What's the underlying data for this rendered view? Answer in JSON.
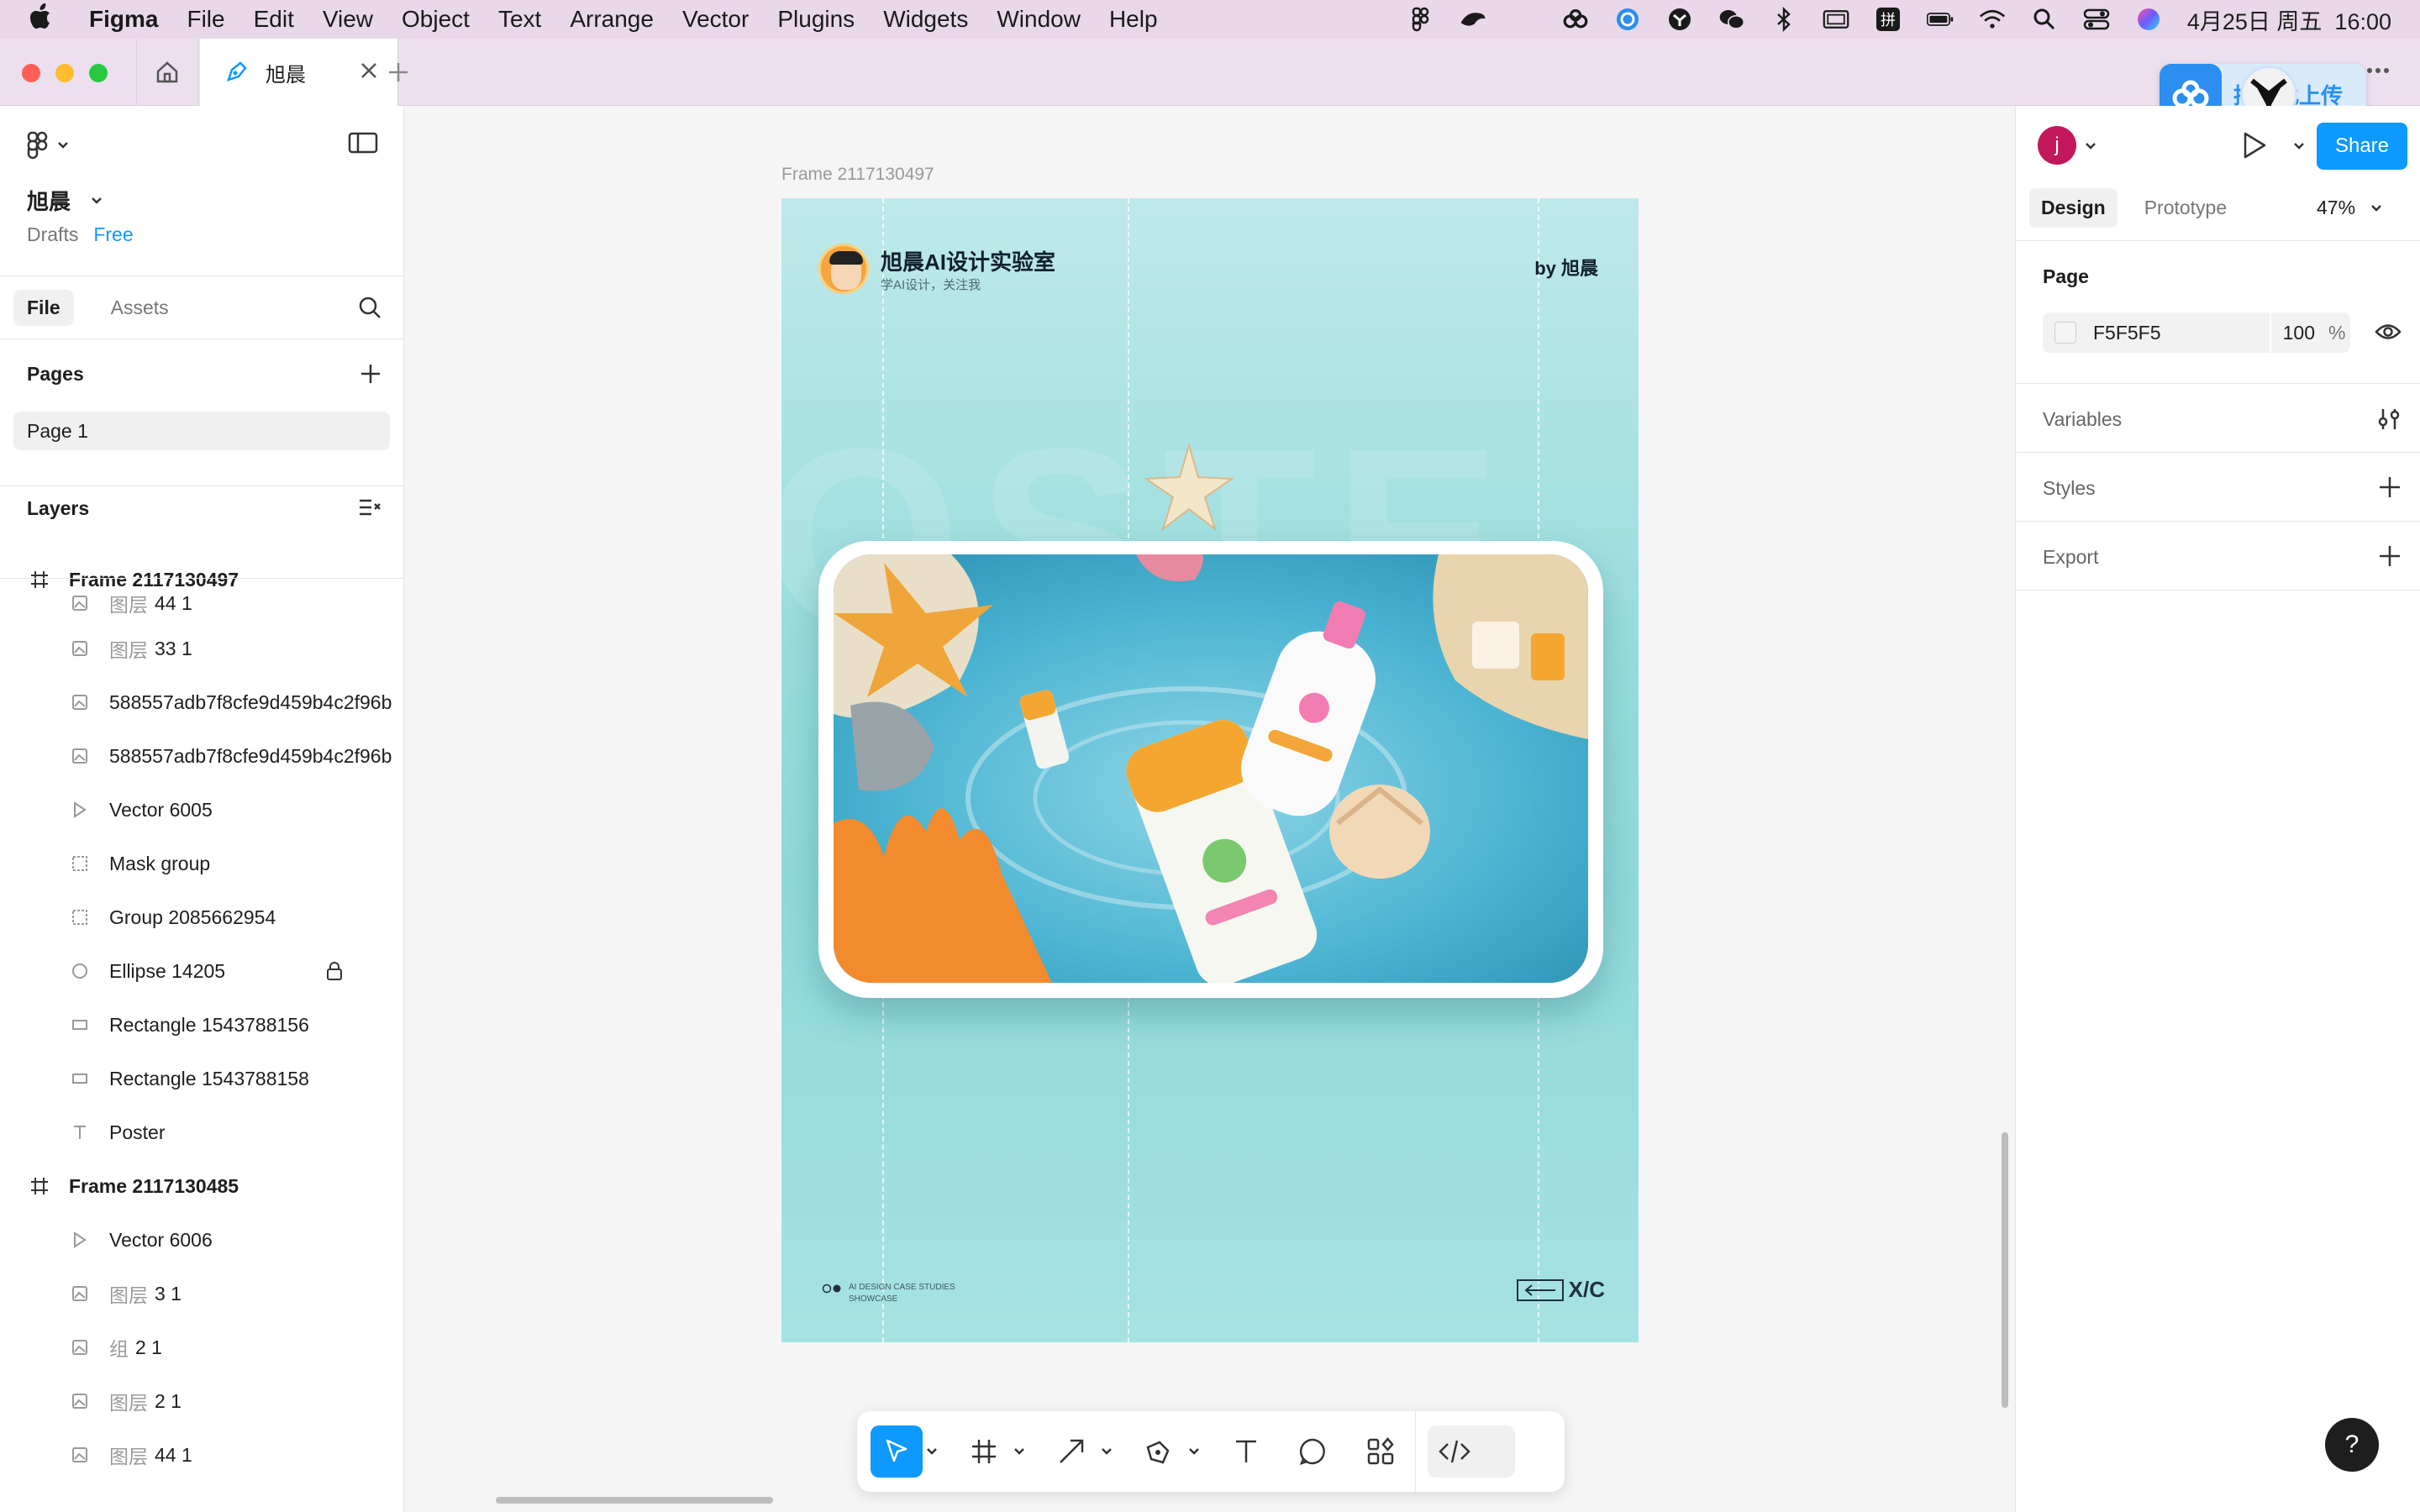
{
  "menubar": {
    "app": "Figma",
    "items": [
      "File",
      "Edit",
      "View",
      "Object",
      "Text",
      "Arrange",
      "Vector",
      "Plugins",
      "Widgets",
      "Window",
      "Help"
    ],
    "datetime": "4月25日 周五  16:00"
  },
  "tabs": {
    "active_label": "旭晨"
  },
  "upload_widget": {
    "label": "拖至此上传"
  },
  "left_panel": {
    "team_name": "旭晨",
    "drafts": "Drafts",
    "plan": "Free",
    "tabs": [
      "File",
      "Assets"
    ],
    "pages_heading": "Pages",
    "page_item": "Page 1",
    "layers_heading": "Layers",
    "layers": [
      {
        "prefix": "",
        "name": "Frame 2117130497"
      },
      {
        "prefix": "图层",
        "name": "44 1"
      },
      {
        "prefix": "图层",
        "name": "33 1"
      },
      {
        "prefix": "",
        "name": "588557adb7f8cfe9d459b4c2f96b"
      },
      {
        "prefix": "",
        "name": "588557adb7f8cfe9d459b4c2f96b"
      },
      {
        "prefix": "",
        "name": "Vector 6005"
      },
      {
        "prefix": "",
        "name": "Mask group"
      },
      {
        "prefix": "",
        "name": "Group 2085662954"
      },
      {
        "prefix": "",
        "name": "Ellipse 14205"
      },
      {
        "prefix": "",
        "name": "Rectangle 1543788156"
      },
      {
        "prefix": "",
        "name": "Rectangle 1543788158"
      },
      {
        "prefix": "",
        "name": "Poster"
      },
      {
        "prefix": "",
        "name": "Frame 2117130485"
      },
      {
        "prefix": "",
        "name": "Vector 6006"
      },
      {
        "prefix": "图层",
        "name": "3 1"
      },
      {
        "prefix": "组",
        "name": "2 1"
      },
      {
        "prefix": "图层",
        "name": "2 1"
      },
      {
        "prefix": "图层",
        "name": "44 1"
      }
    ]
  },
  "canvas": {
    "frame_label": "Frame 2117130497",
    "poster": {
      "title": "旭晨AI设计实验室",
      "subtitle": "学AI设计，关注我",
      "byline": "by 旭晨",
      "footer_line1": "AI DESIGN CASE STUDIES",
      "footer_line2": "SHOWCASE",
      "nav_label": "X/C"
    }
  },
  "right_panel": {
    "avatar_letter": "j",
    "share_label": "Share",
    "tabs": [
      "Design",
      "Prototype"
    ],
    "zoom": "47%",
    "page_heading": "Page",
    "fill_hex": "F5F5F5",
    "fill_opacity": "100",
    "fill_unit": "%",
    "variables_heading": "Variables",
    "styles_heading": "Styles",
    "export_heading": "Export",
    "help_label": "?"
  },
  "colors": {
    "accent": "#0d99ff",
    "menubar_bg": "#e8d8ea",
    "poster_bg": "#98dcdd"
  }
}
